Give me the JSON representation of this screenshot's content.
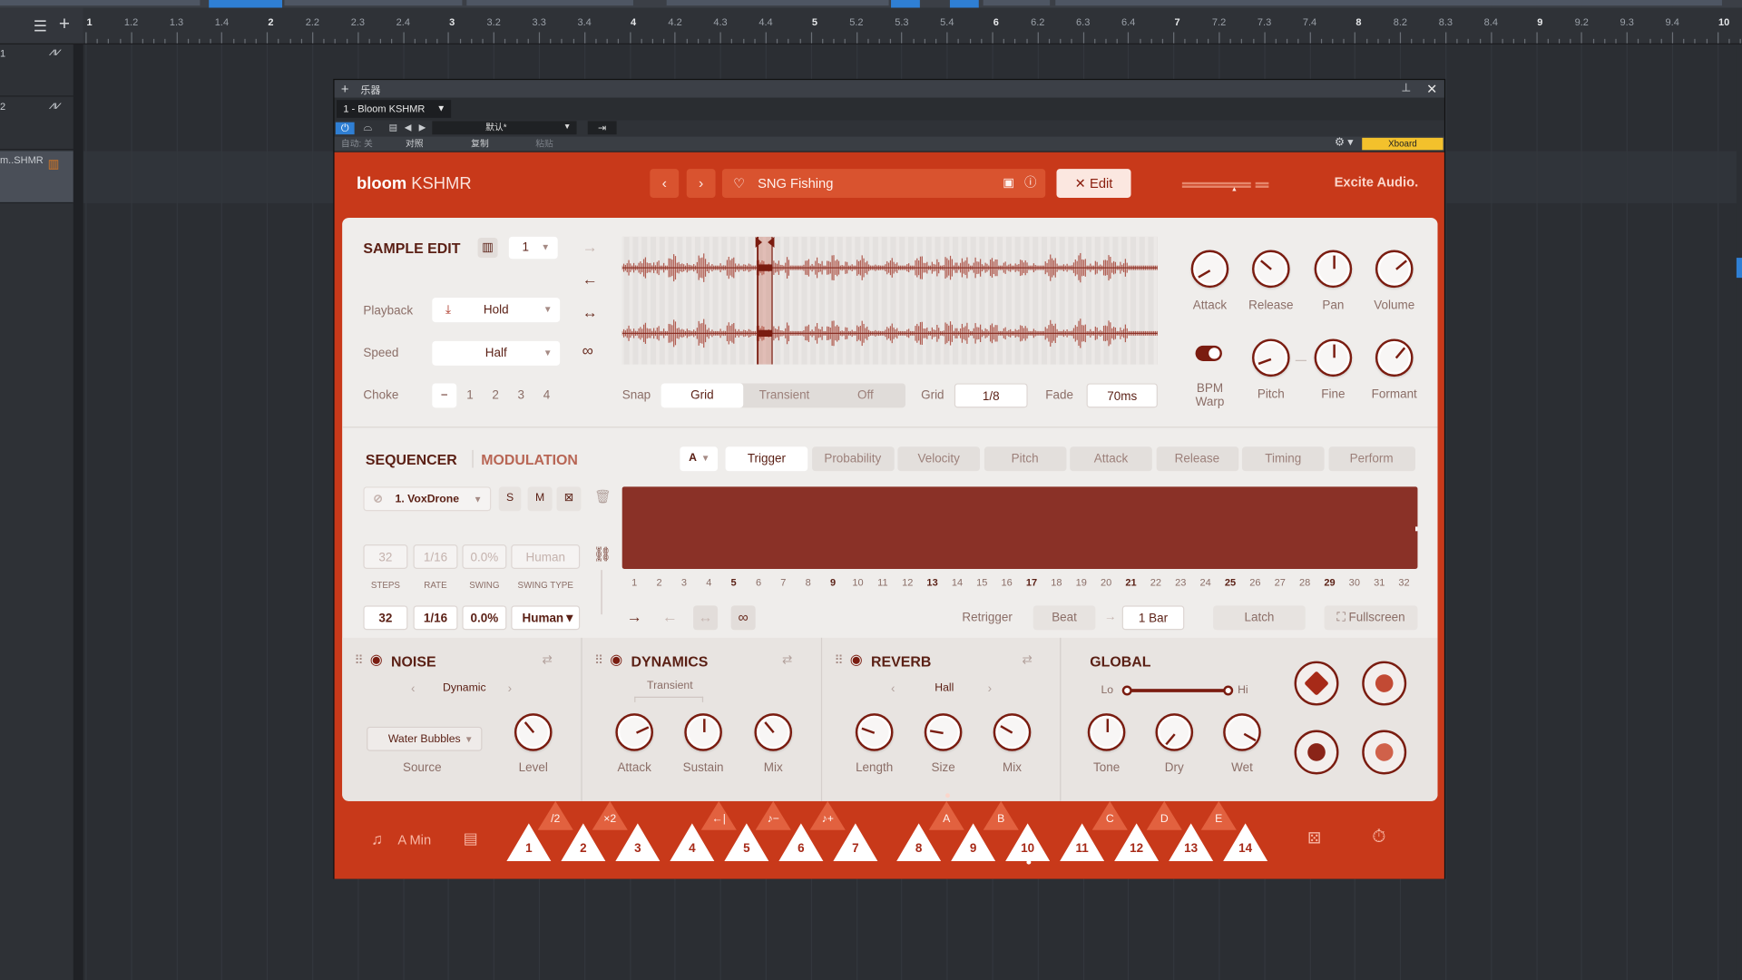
{
  "daw": {
    "ruler_ticks": [
      {
        "label": "1",
        "major": true
      },
      {
        "label": "1.2"
      },
      {
        "label": "1.3"
      },
      {
        "label": "1.4"
      },
      {
        "label": "2",
        "major": true
      },
      {
        "label": "2.2"
      },
      {
        "label": "2.3"
      },
      {
        "label": "2.4"
      },
      {
        "label": "3",
        "major": true
      },
      {
        "label": "3.2"
      },
      {
        "label": "3.3"
      },
      {
        "label": "3.4"
      },
      {
        "label": "4",
        "major": true
      },
      {
        "label": "4.2"
      },
      {
        "label": "4.3"
      },
      {
        "label": "4.4"
      },
      {
        "label": "5",
        "major": true
      },
      {
        "label": "5.2"
      },
      {
        "label": "5.3"
      },
      {
        "label": "5.4"
      },
      {
        "label": "6",
        "major": true
      },
      {
        "label": "6.2"
      },
      {
        "label": "6.3"
      },
      {
        "label": "6.4"
      },
      {
        "label": "7",
        "major": true
      },
      {
        "label": "7.2"
      },
      {
        "label": "7.3"
      },
      {
        "label": "7.4"
      },
      {
        "label": "8",
        "major": true
      },
      {
        "label": "8.2"
      },
      {
        "label": "8.3"
      },
      {
        "label": "8.4"
      },
      {
        "label": "9",
        "major": true
      },
      {
        "label": "9.2"
      },
      {
        "label": "9.3"
      },
      {
        "label": "9.4"
      },
      {
        "label": "10",
        "major": true
      }
    ],
    "tracks": [
      {
        "num": "1",
        "icon": "waveform-icon"
      },
      {
        "num": "2",
        "icon": "waveform-icon"
      },
      {
        "num": "m..SHMR",
        "icon": "keyboard-icon",
        "selected": true
      }
    ]
  },
  "window": {
    "title": "乐器",
    "instrument": "1 - Bloom KSHMR",
    "preset": "默认*",
    "row2": [
      "自动: 关",
      "对照",
      "复制",
      "粘贴"
    ],
    "xboard": "Xboard"
  },
  "header": {
    "logo_bold": "bloom",
    "logo_rest": "KSHMR",
    "preset_name": "SNG Fishing",
    "edit_label": "Edit",
    "brand": "Excite Audio."
  },
  "sample_edit": {
    "title": "SAMPLE EDIT",
    "slot": "1",
    "playback_label": "Playback",
    "playback_value": "Hold",
    "speed_label": "Speed",
    "speed_value": "Half",
    "choke_label": "Choke",
    "choke_options": [
      "−",
      "1",
      "2",
      "3",
      "4"
    ],
    "snap_label": "Snap",
    "snap_options": [
      "Grid",
      "Transient",
      "Off"
    ],
    "grid_label": "Grid",
    "grid_value": "1/8",
    "fade_label": "Fade",
    "fade_value": "70ms",
    "knobs_top": [
      {
        "label": "Attack",
        "angle": -120
      },
      {
        "label": "Release",
        "angle": -50
      },
      {
        "label": "Pan",
        "angle": 0
      },
      {
        "label": "Volume",
        "angle": 50
      }
    ],
    "knobs_bottom": [
      {
        "label": "Pitch",
        "angle": -110
      },
      {
        "label": "Fine",
        "angle": 0
      },
      {
        "label": "Formant",
        "angle": 40
      }
    ],
    "bpm_warp_line1": "BPM",
    "bpm_warp_line2": "Warp"
  },
  "sequencer": {
    "title": "SEQUENCER",
    "mod_title": "MODULATION",
    "pattern": "A",
    "tabs": [
      "Trigger",
      "Probability",
      "Velocity",
      "Pitch",
      "Attack",
      "Release",
      "Timing",
      "Perform"
    ],
    "track_name": "1. VoxDrone",
    "solo": "S",
    "mute": "M",
    "dim_fields": [
      "32",
      "1/16",
      "0.0%",
      "Human"
    ],
    "field_labels": [
      "STEPS",
      "RATE",
      "SWING",
      "SWING TYPE"
    ],
    "fields": [
      "32",
      "1/16",
      "0.0%",
      "Human"
    ],
    "steps": [
      "1",
      "2",
      "3",
      "4",
      "5",
      "6",
      "7",
      "8",
      "9",
      "10",
      "11",
      "12",
      "13",
      "14",
      "15",
      "16",
      "17",
      "18",
      "19",
      "20",
      "21",
      "22",
      "23",
      "24",
      "25",
      "26",
      "27",
      "28",
      "29",
      "30",
      "31",
      "32"
    ],
    "bold_steps": [
      "5",
      "9",
      "13",
      "17",
      "21",
      "25",
      "29"
    ],
    "retrigger_label": "Retrigger",
    "retrigger_from": "Beat",
    "retrigger_to": "1 Bar",
    "latch": "Latch",
    "fullscreen": "Fullscreen"
  },
  "fx": {
    "noise": {
      "title": "NOISE",
      "mode": "Dynamic",
      "source_value": "Water Bubbles",
      "source_label": "Source",
      "level_label": "Level"
    },
    "dynamics": {
      "title": "DYNAMICS",
      "sub": "Transient",
      "knobs": [
        "Attack",
        "Sustain",
        "Mix"
      ]
    },
    "reverb": {
      "title": "REVERB",
      "mode": "Hall",
      "knobs": [
        "Length",
        "Size",
        "Mix"
      ]
    },
    "global": {
      "title": "GLOBAL",
      "lo": "Lo",
      "hi": "Hi",
      "knobs": [
        "Tone",
        "Dry",
        "Wet"
      ]
    }
  },
  "keys": {
    "scale": "A Min",
    "main": [
      "1",
      "2",
      "3",
      "4",
      "5",
      "6",
      "7",
      "8",
      "9",
      "10",
      "11",
      "12",
      "13",
      "14"
    ],
    "small": [
      "/2",
      "×2",
      "←|",
      "♪−",
      "♪+",
      "A",
      "B",
      "C",
      "D",
      "E"
    ]
  }
}
